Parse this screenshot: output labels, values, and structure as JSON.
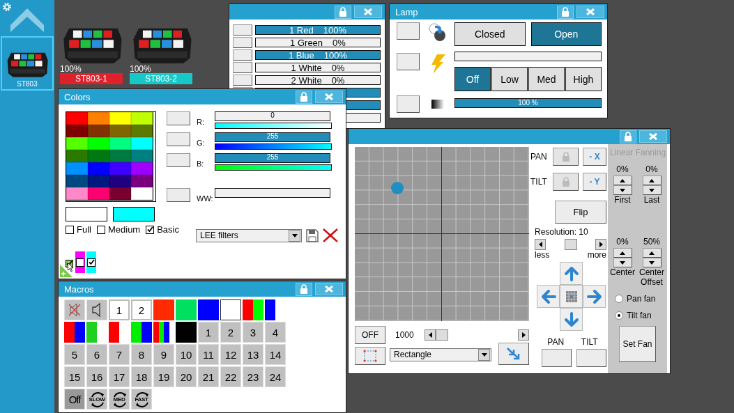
{
  "sidebar": {
    "items": [
      {
        "label": "ST803",
        "selected": true
      }
    ]
  },
  "fixtures": [
    {
      "level_text": "100%",
      "name": "ST803-1",
      "color": "#e0202a"
    },
    {
      "level_text": "100%",
      "name": "ST803-2",
      "color": "#16c8c8"
    }
  ],
  "channels_window": {
    "rows": [
      {
        "label": "1 Red",
        "value": "100%",
        "level": 1
      },
      {
        "label": "1 Green",
        "value": "0%",
        "level": 0
      },
      {
        "label": "1 Blue",
        "value": "100%",
        "level": 1
      },
      {
        "label": "1 White",
        "value": "0%",
        "level": 0
      },
      {
        "label": "2 White",
        "value": "0%",
        "level": 0
      },
      {
        "level": 1
      },
      {
        "level": 1
      },
      {
        "level": 0
      }
    ]
  },
  "lamp_window": {
    "title": "Lamp",
    "shutter": [
      {
        "label": "Closed",
        "selected": false
      },
      {
        "label": "Open",
        "selected": true
      }
    ],
    "strobe": {
      "level": 0
    },
    "strobe_modes": [
      {
        "label": "Off",
        "selected": true
      },
      {
        "label": "Low",
        "selected": false
      },
      {
        "label": "Med",
        "selected": false
      },
      {
        "label": "High",
        "selected": false
      }
    ],
    "dimmer": {
      "level": 1,
      "reading": "100 %"
    }
  },
  "colors_window": {
    "title": "Colors",
    "palette": [
      {
        "color": "#ff0000"
      },
      {
        "color": "#ff8000"
      },
      {
        "color": "#ffff00"
      },
      {
        "color": "#bfff00"
      },
      {
        "color": "#800000"
      },
      {
        "color": "#803300"
      },
      {
        "color": "#806600"
      },
      {
        "color": "#5c7a00"
      },
      {
        "color": "#55ff00"
      },
      {
        "color": "#00ff00"
      },
      {
        "color": "#00ff80"
      },
      {
        "color": "#00ffff"
      },
      {
        "color": "#2a7a00"
      },
      {
        "color": "#007a10"
      },
      {
        "color": "#007a40"
      },
      {
        "color": "#008080"
      },
      {
        "color": "#0090ff"
      },
      {
        "color": "#0000ff"
      },
      {
        "color": "#4000ff"
      },
      {
        "color": "#a000ff"
      },
      {
        "color": "#004880"
      },
      {
        "color": "#001880"
      },
      {
        "color": "#200080"
      },
      {
        "color": "#7a0080"
      },
      {
        "color": "#ff88c8"
      },
      {
        "color": "#ff0070"
      },
      {
        "color": "#7a0030"
      },
      {
        "color": "#ffffff"
      }
    ],
    "swatches": [
      {
        "color": "#ffffff"
      },
      {
        "color": "#00ffff"
      }
    ],
    "sets": [
      {
        "label": "Full",
        "checked": false
      },
      {
        "label": "Medium",
        "checked": false
      },
      {
        "label": "Basic",
        "checked": true
      }
    ],
    "sliders": [
      {
        "kind": "rgb",
        "label": "R:",
        "value": "0",
        "level": 0
      },
      {
        "kind": "rgb",
        "label": "G:",
        "value": "255",
        "level": 1
      },
      {
        "kind": "rgb",
        "label": "B:",
        "value": "255",
        "level": 1
      },
      {
        "kind": "white",
        "label": "WW:",
        "level": 0
      }
    ],
    "filter_dropdown": "LEE filters",
    "preset_toggle": {
      "checked": true
    },
    "presets": [
      {
        "color": "#ff00ff",
        "checked": false
      },
      {
        "color": "#00ffff",
        "checked": true
      }
    ]
  },
  "macros_window": {
    "title": "Macros",
    "items": [
      {
        "kind": "mute"
      },
      {
        "kind": "sound"
      },
      {
        "kind": "preset",
        "label": "1"
      },
      {
        "kind": "preset",
        "label": "2"
      },
      {
        "kind": "color",
        "colors": [
          {
            "color": "#ff2a00"
          }
        ]
      },
      {
        "kind": "color",
        "colors": [
          {
            "color": "#00e060"
          }
        ]
      },
      {
        "kind": "color",
        "colors": [
          {
            "color": "#0000ff"
          }
        ]
      },
      {
        "kind": "color",
        "colors": [
          {
            "color": "#ffffff"
          }
        ]
      },
      {
        "kind": "color",
        "colors": [
          {
            "color": "#ff0000"
          },
          {
            "color": "#00ff00"
          }
        ]
      },
      {
        "kind": "narrow_color",
        "colors": [
          {
            "color": "#0000ff"
          }
        ]
      },
      {
        "kind": "color",
        "colors": [
          {
            "color": "#ff0000"
          },
          {
            "color": "#0000ff"
          }
        ]
      },
      {
        "kind": "narrow_color",
        "colors": [
          {
            "color": "#20d020"
          }
        ]
      },
      {
        "kind": "narrow_color",
        "colors": [
          {
            "color": "#ff0000"
          }
        ]
      },
      {
        "kind": "color",
        "colors": [
          {
            "color": "#00ee00"
          },
          {
            "color": "#0000ff"
          }
        ]
      },
      {
        "kind": "color",
        "colors": [
          {
            "color": "#ff0000"
          },
          {
            "color": "#00ee00"
          },
          {
            "color": "#0000ff"
          },
          {
            "color": "#ffffff"
          }
        ]
      },
      {
        "kind": "color",
        "colors": [
          {
            "color": "#000000"
          }
        ]
      },
      {
        "kind": "number",
        "label": "1"
      },
      {
        "kind": "number",
        "label": "2"
      },
      {
        "kind": "number",
        "label": "3"
      },
      {
        "kind": "number",
        "label": "4"
      },
      {
        "kind": "number",
        "label": "5"
      },
      {
        "kind": "number",
        "label": "6"
      },
      {
        "kind": "number",
        "label": "7"
      },
      {
        "kind": "number",
        "label": "8"
      },
      {
        "kind": "number",
        "label": "9"
      },
      {
        "kind": "number",
        "label": "10"
      },
      {
        "kind": "number",
        "label": "11"
      },
      {
        "kind": "number",
        "label": "12"
      },
      {
        "kind": "number",
        "label": "13"
      },
      {
        "kind": "number",
        "label": "14"
      },
      {
        "kind": "number",
        "label": "15"
      },
      {
        "kind": "number",
        "label": "16"
      },
      {
        "kind": "number",
        "label": "17"
      },
      {
        "kind": "number",
        "label": "18"
      },
      {
        "kind": "number",
        "label": "19"
      },
      {
        "kind": "number",
        "label": "20"
      },
      {
        "kind": "number",
        "label": "21"
      },
      {
        "kind": "number",
        "label": "22"
      },
      {
        "kind": "number",
        "label": "23"
      },
      {
        "kind": "number",
        "label": "24"
      },
      {
        "kind": "speed_off",
        "label": "Off",
        "selected": true
      },
      {
        "kind": "speed",
        "label": "SLOW",
        "selected": false
      },
      {
        "kind": "speed",
        "label": "MED",
        "selected": false
      },
      {
        "kind": "speed",
        "label": "FAST",
        "selected": false
      }
    ]
  },
  "position_window": {
    "pan_label": "PAN",
    "tilt_label": "TILT",
    "pan_lock": {
      "disabled": true
    },
    "tilt_lock": {
      "disabled": true
    },
    "invert_x": "- X",
    "invert_y": "- Y",
    "flip": "Flip",
    "resolution": "Resolution: 10",
    "resolution_slider": {
      "level": 0.5
    },
    "less": "less",
    "more": "more",
    "off_button": "OFF",
    "speed_value": "1000",
    "speed_slider": {
      "level": 0
    },
    "shape_dropdown": "Rectangle",
    "bottom_labels": [
      "PAN",
      "TILT"
    ],
    "fanning": {
      "title": "Linear Fanning",
      "spinners": [
        {
          "value": "0%",
          "label": "First"
        },
        {
          "value": "0%",
          "label": "Last"
        },
        {
          "value": "0%",
          "label": "Center"
        },
        {
          "value": "50%",
          "label": "Center Offset"
        }
      ],
      "modes": [
        {
          "label": "Pan fan",
          "selected": false
        },
        {
          "label": "Tilt fan",
          "selected": true
        }
      ],
      "set_button": "Set Fan"
    }
  }
}
